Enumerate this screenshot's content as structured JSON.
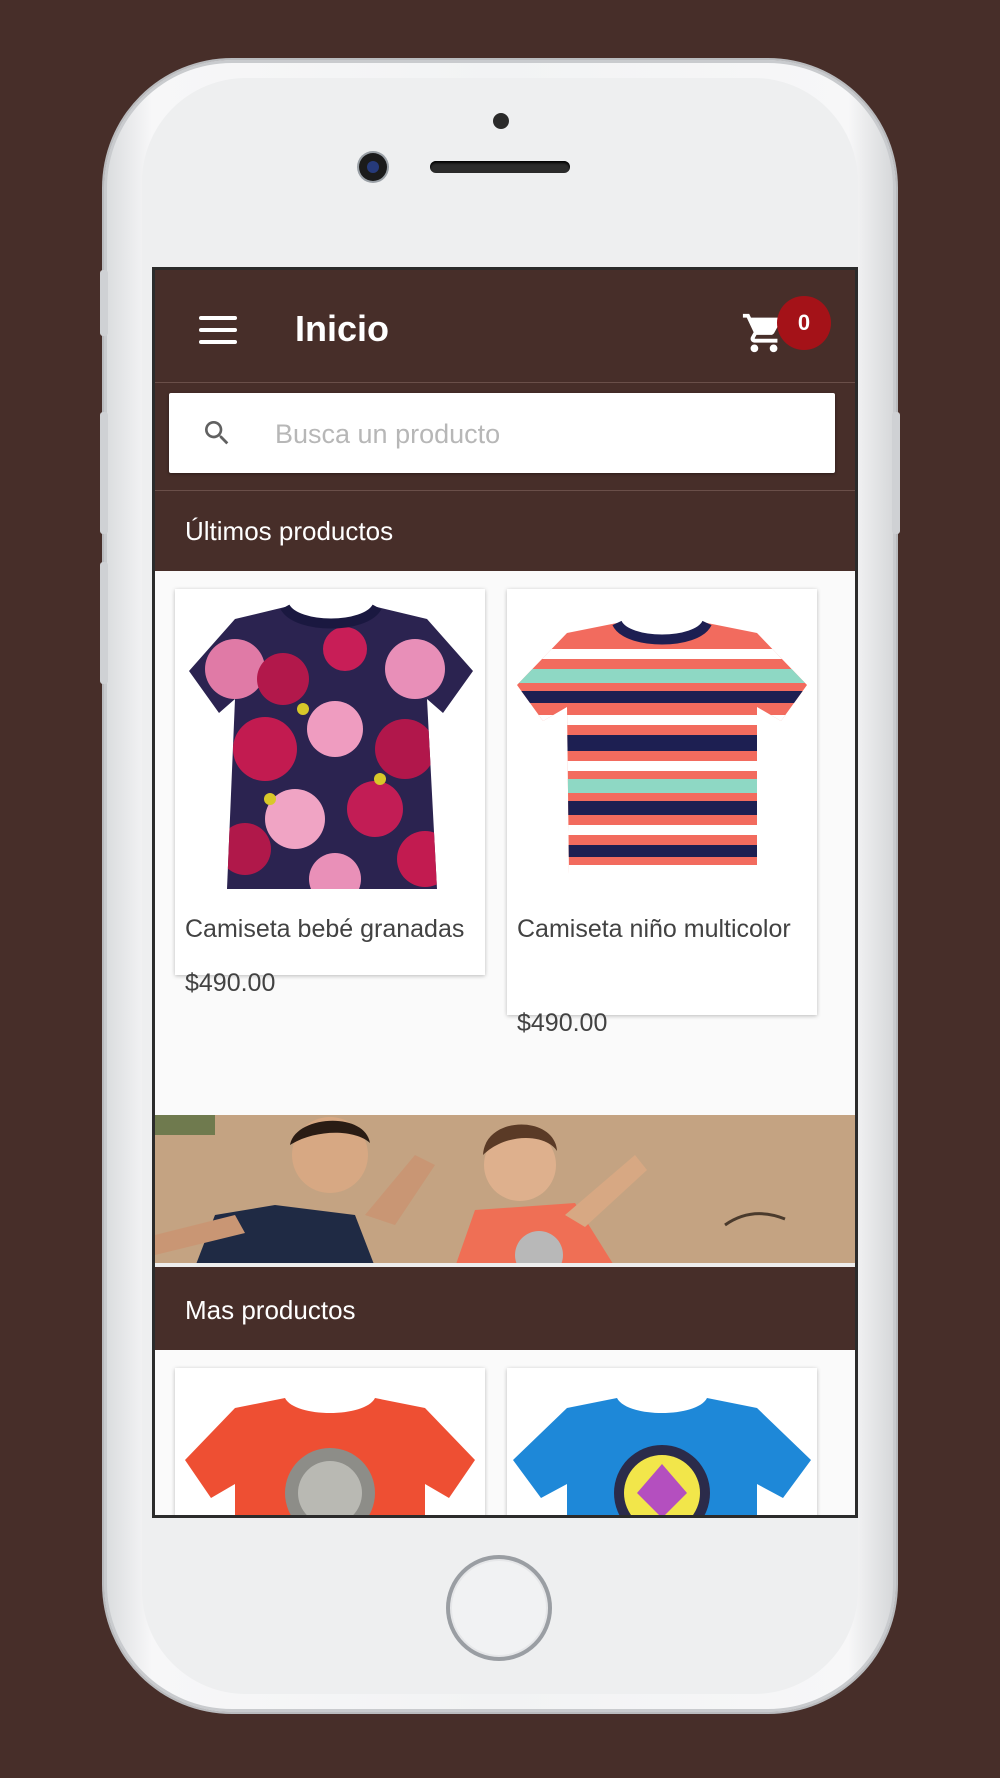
{
  "app": {
    "title": "Inicio",
    "cart_count": "0"
  },
  "search": {
    "placeholder": "Busca un producto",
    "value": ""
  },
  "sections": {
    "latest": "Últimos productos",
    "more": "Mas productos"
  },
  "latest_products": [
    {
      "name": "Camiseta bebé granadas",
      "price": "$490.00"
    },
    {
      "name": "Camiseta niño multicolor",
      "price": "$490.00"
    }
  ],
  "colors": {
    "brand": "#472e29",
    "badge": "#a41218",
    "background": "#fafafa"
  },
  "icons": [
    "menu-icon",
    "cart-icon",
    "search-icon"
  ]
}
